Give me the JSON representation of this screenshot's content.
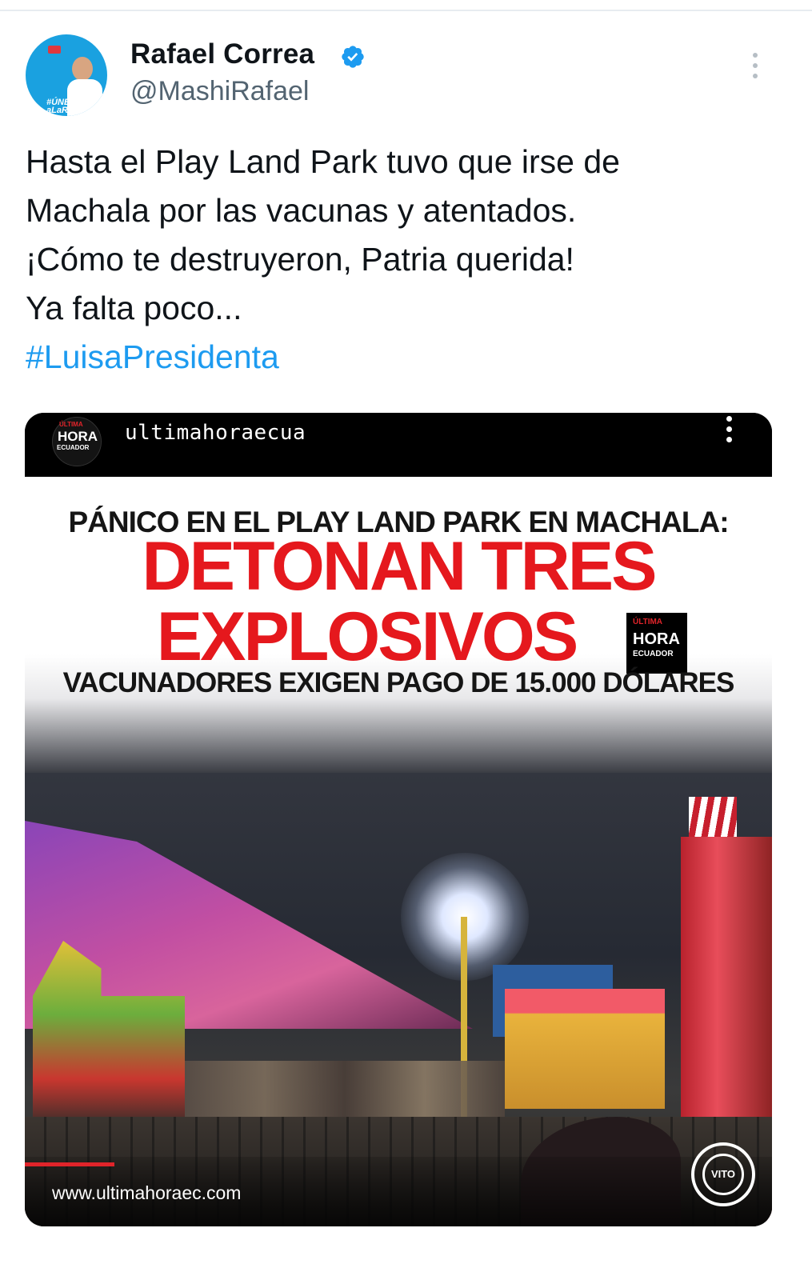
{
  "tweet": {
    "author_name": "Rafael Correa",
    "author_handle": "@MashiRafael",
    "avatar_text": "#ÚNETE aLaRC",
    "text_lines": [
      "Hasta el Play Land Park tuvo que irse de",
      "Machala por las vacunas y atentados.",
      "¡Cómo te destruyeron, Patria querida!",
      "Ya falta poco..."
    ],
    "hashtag": "#LuisaPresidenta",
    "verified_icon": "verified-badge-icon",
    "more_icon": "more-vertical-icon"
  },
  "media": {
    "account": "ultimahoraecua",
    "logo_line1": "ÚLTIMA",
    "logo_line2": "HORA",
    "logo_line3": "ECUADOR",
    "headline_top": "PÁNICO EN EL PLAY LAND PARK EN MACHALA:",
    "headline_main_1": "DETONAN TRES",
    "headline_main_2": "EXPLOSIVOS",
    "headline_sub": "VACUNADORES EXIGEN PAGO DE 15.000 DÓLARES",
    "site_url": "www.ultimahoraec.com",
    "watermark": "VITO",
    "progress": 0.12
  },
  "colors": {
    "hashtag": "#1d9bf0",
    "headline_red": "#e5181d",
    "verified": "#1d9bf0",
    "secondary_text": "#536471"
  }
}
